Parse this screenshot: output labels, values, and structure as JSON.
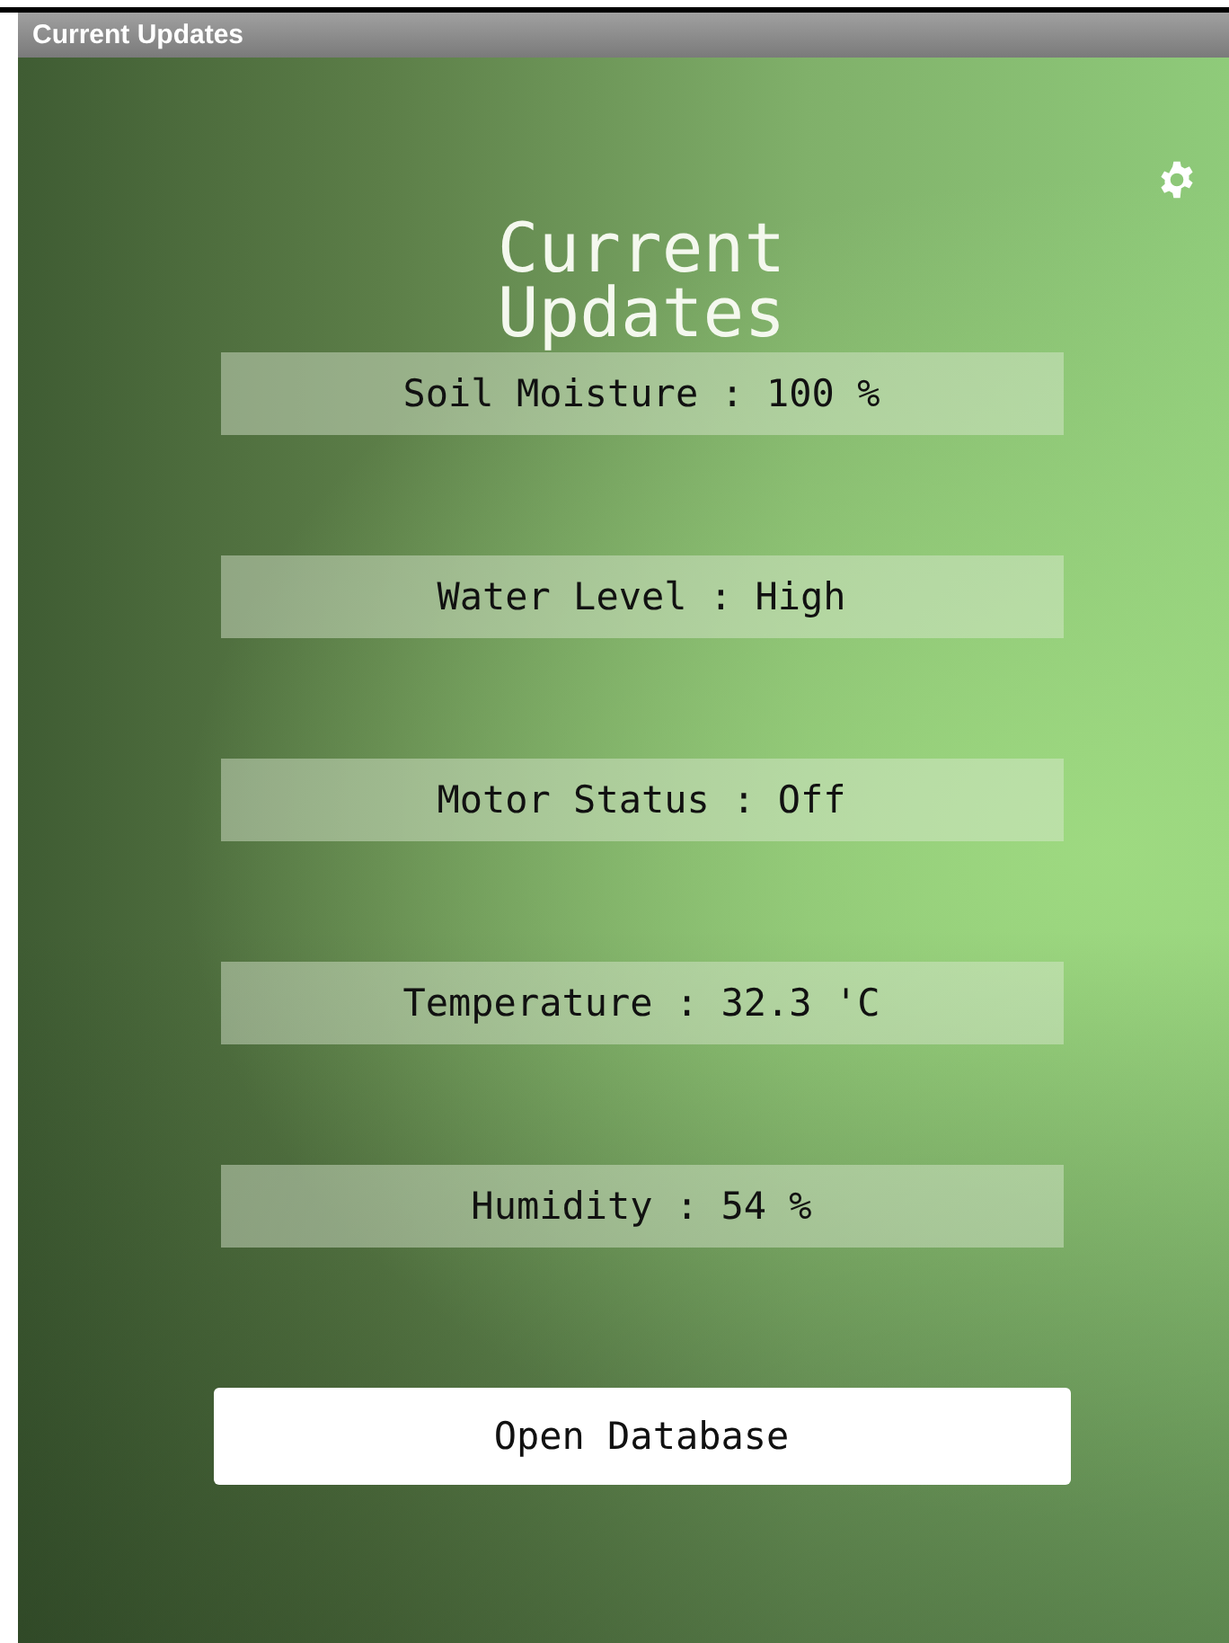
{
  "window": {
    "title": "Current Updates"
  },
  "heading": "Current Updates",
  "readings": [
    {
      "label": "Soil Moisture : 100 %"
    },
    {
      "label": "Water Level : High"
    },
    {
      "label": "Motor Status : Off"
    },
    {
      "label": "Temperature : 32.3 'C"
    },
    {
      "label": "Humidity : 54 %"
    }
  ],
  "button": "Open Database"
}
